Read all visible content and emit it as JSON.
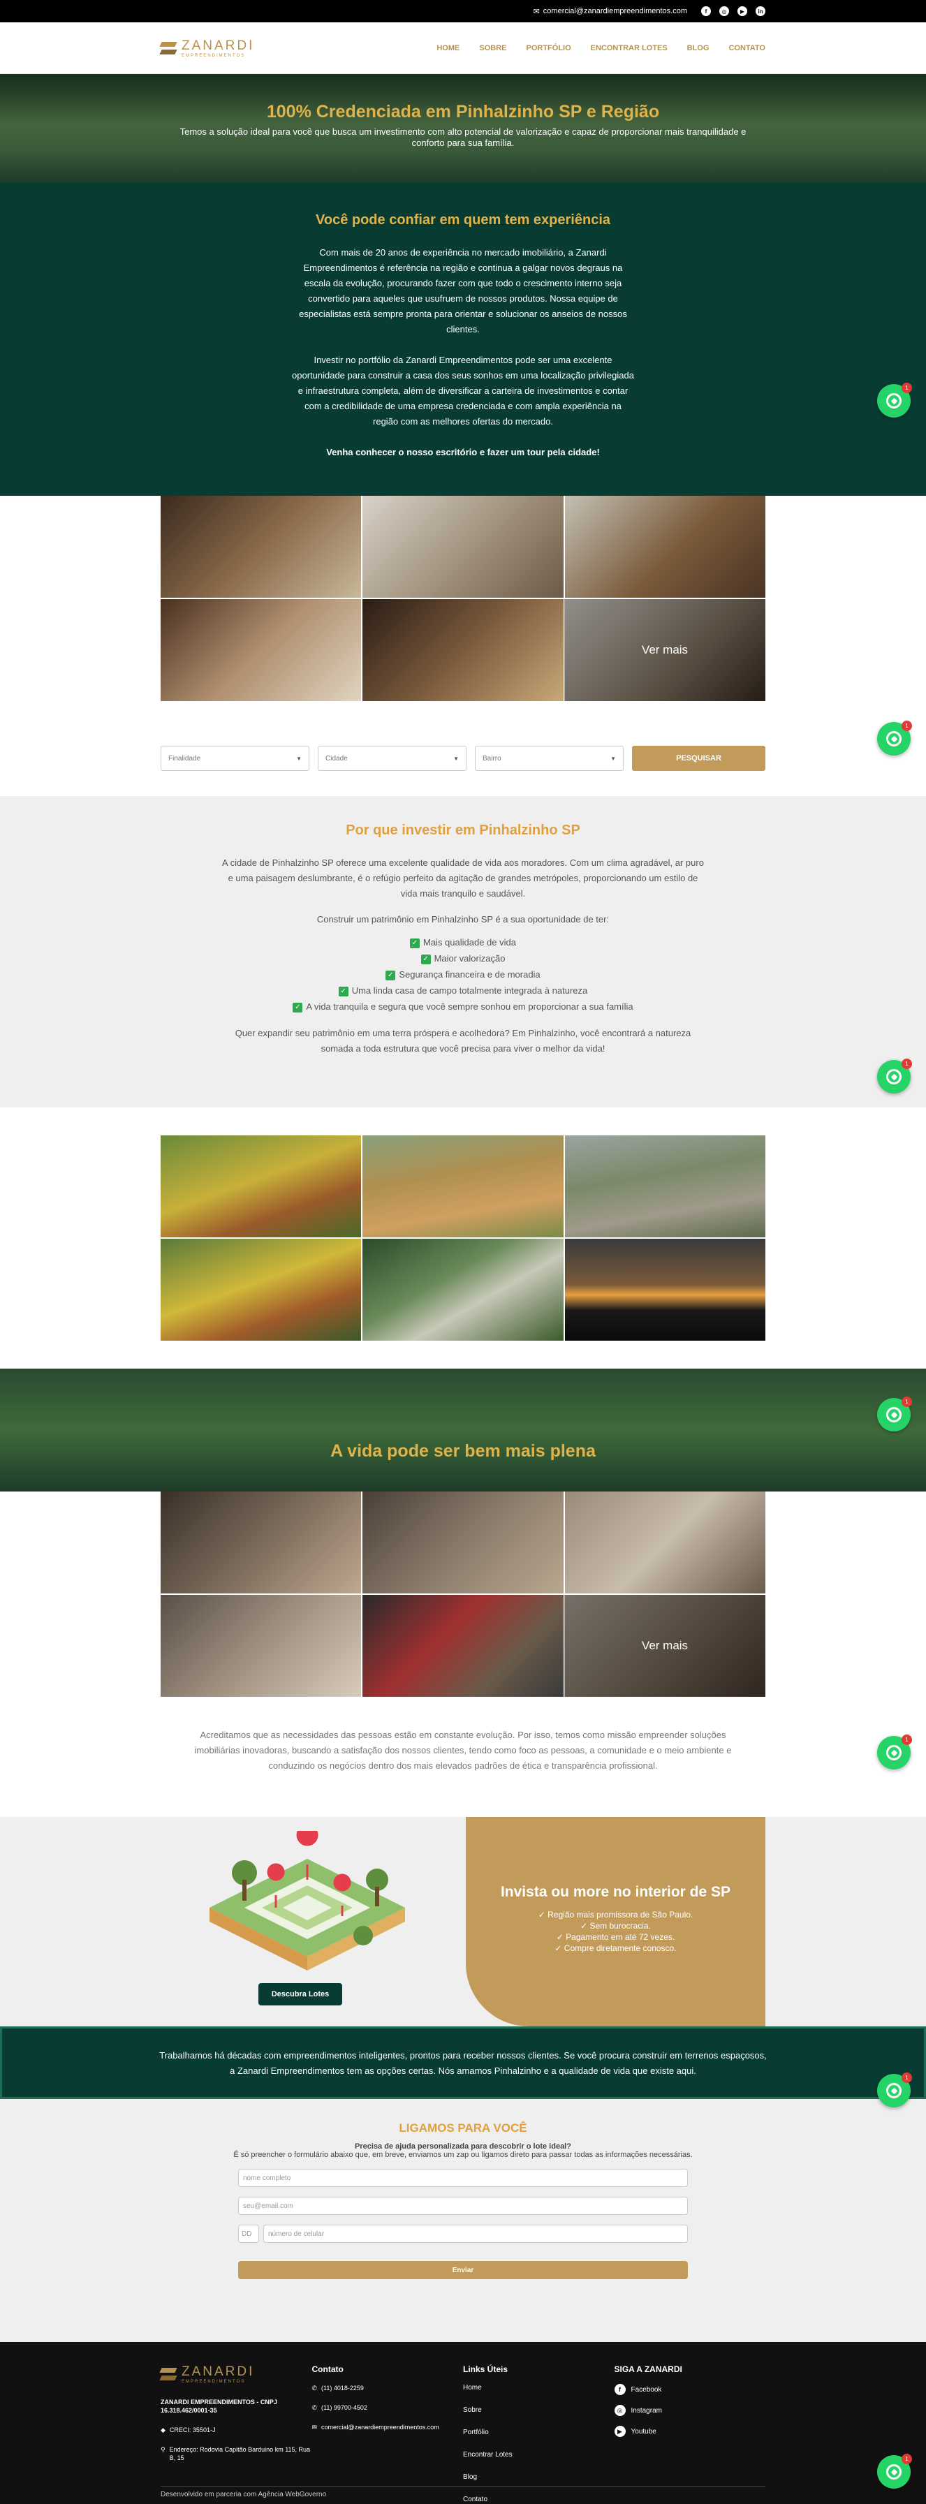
{
  "topbar": {
    "email": "comercial@zanardiempreendimentos.com",
    "social": [
      "facebook-icon",
      "instagram-icon",
      "youtube-icon",
      "linkedin-icon"
    ]
  },
  "header": {
    "logo_name": "ZANARDI",
    "logo_sub": "EMPREENDIMENTOS",
    "nav": [
      "HOME",
      "SOBRE",
      "PORTFÓLIO",
      "ENCONTRAR LOTES",
      "BLOG",
      "CONTATO"
    ]
  },
  "hero": {
    "title": "100% Credenciada em Pinhalzinho SP e Região",
    "subtitle": "Temos a solução ideal para você que busca um investimento com alto potencial de valorização e capaz de proporcionar mais tranquilidade e conforto para sua família."
  },
  "trust": {
    "title": "Você pode confiar em quem tem experiência",
    "p1": "Com mais de 20 anos de experiência no mercado imobiliário, a Zanardi Empreendimentos é referência na região e continua a galgar novos degraus na escala da evolução, procurando fazer com que todo o crescimento interno seja convertido para aqueles que usufruem de nossos produtos. Nossa equipe de especialistas está sempre pronta para orientar e solucionar os anseios de nossos clientes.",
    "p2": "Investir no portfólio da Zanardi Empreendimentos pode ser uma excelente oportunidade para construir a casa dos seus sonhos em uma localização privilegiada e infraestrutura completa, além de diversificar a carteira de investimentos e contar com a credibilidade de uma empresa credenciada e com ampla experiência na região com as melhores ofertas do mercado.",
    "cta": "Venha conhecer o nosso escritório e fazer um tour pela cidade!"
  },
  "office_gallery": {
    "see_more": "Ver mais"
  },
  "search": {
    "finalidade": "Finalidade",
    "cidade": "Cidade",
    "bairro": "Bairro",
    "button": "PESQUISAR"
  },
  "why": {
    "title": "Por que investir em Pinhalzinho SP",
    "p1": "A cidade de Pinhalzinho SP oferece uma excelente qualidade de vida aos moradores. Com um clima agradável, ar puro e uma paisagem deslumbrante, é o refúgio perfeito da agitação de grandes metrópoles, proporcionando um estilo de vida mais tranquilo e saudável.",
    "p2": "Construir um patrimônio em Pinhalzinho SP é a sua oportunidade de ter:",
    "items": [
      "Mais qualidade de vida",
      "Maior valorização",
      "Segurança financeira e de moradia",
      "Uma linda casa de campo totalmente integrada à natureza",
      "A vida tranquila e segura que você sempre sonhou em proporcionar a sua família"
    ],
    "p3": "Quer expandir seu patrimônio em uma terra próspera e acolhedora? Em Pinhalzinho, você encontrará a natureza somada a toda estrutura que você precisa para viver o melhor da vida!"
  },
  "vida": {
    "title": "A vida pode ser bem mais plena"
  },
  "people_gallery": {
    "see_more": "Ver mais"
  },
  "acredit": {
    "text": "Acreditamos que as necessidades das pessoas estão em constante evolução. Por isso, temos como missão empreender soluções imobiliárias inovadoras, buscando a satisfação dos nossos clientes, tendo como foco as pessoas, a comunidade e o meio ambiente e conduzindo os negócios dentro dos mais elevados padrões de ética e transparência profissional."
  },
  "invest": {
    "button": "Descubra Lotes",
    "title": "Invista ou more no interior de SP",
    "items": [
      "✓ Região mais promissora de São Paulo.",
      "✓ Sem burocracia.",
      "✓ Pagamento em até 72 vezes.",
      "✓ Compre diretamente conosco."
    ]
  },
  "trab": {
    "text": "Trabalhamos há décadas com empreendimentos inteligentes, prontos para receber nossos clientes. Se você procura construir em terrenos espaçosos, a Zanardi Empreendimentos tem as opções certas. Nós amamos Pinhalzinho e a qualidade de vida que existe aqui."
  },
  "form": {
    "title": "LIGAMOS PARA VOCÊ",
    "s1": "Precisa de ajuda personalizada para descobrir o lote ideal?",
    "s2": "É só preencher o formulário abaixo que, em breve, enviamos um zap ou ligamos direto para passar todas as informações necessárias.",
    "name_ph": "nome completo",
    "email_ph": "seu@email.com",
    "ddd_ph": "DD",
    "phone_ph": "número de celular",
    "submit": "Enviar"
  },
  "footer": {
    "logo_name": "ZANARDI",
    "logo_sub": "EMPREENDIMENTOS",
    "company": "ZANARDI EMPREENDIMENTOS - CNPJ 16.318.462/0001-35",
    "creci": "CRECI: 35501-J",
    "address": "Endereço: Rodovia Capitão Barduino km 115, Rua B, 15",
    "contato_title": "Contato",
    "phone1": "(11) 4018-2259",
    "phone2": "(11) 99700-4502",
    "email": "comercial@zanardiempreendimentos.com",
    "links_title": "Links Úteis",
    "links": [
      "Home",
      "Sobre",
      "Portfólio",
      "Encontrar Lotes",
      "Blog",
      "Contato"
    ],
    "siga_title": "SIGA A ZANARDI",
    "social": [
      "Facebook",
      "Instagram",
      "Youtube"
    ],
    "copyright": "Desenvolvido em parceria com Agência WebGoverno"
  },
  "whatsapp_badge": "1"
}
